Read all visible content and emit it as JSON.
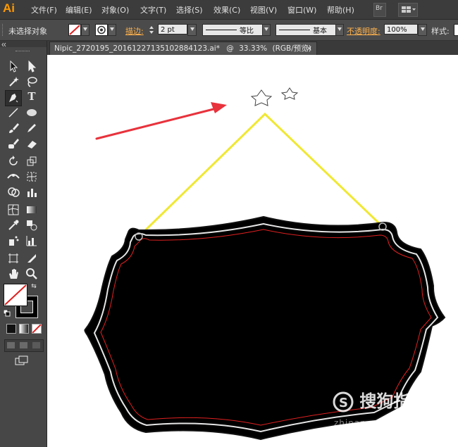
{
  "app": {
    "logo": "Ai"
  },
  "menu": [
    "文件(F)",
    "编辑(E)",
    "对象(O)",
    "文字(T)",
    "选择(S)",
    "效果(C)",
    "视图(V)",
    "窗口(W)",
    "帮助(H)"
  ],
  "menu_buttons": {
    "bridge": "Br"
  },
  "control": {
    "selection": "未选择对象",
    "stroke_label": "描边:",
    "stroke_value": "2 pt",
    "profile_uniform": "等比",
    "brush_basic": "基本",
    "opacity_label": "不透明度:",
    "opacity_value": "100%",
    "style_label": "样式:"
  },
  "document": {
    "tab_title": "Nipic_2720195_20161227135102884123.ai*",
    "zoom": "33.33%",
    "color_mode": "(RGB/预览)",
    "close": "×"
  },
  "toolbox": {
    "tools": [
      "selection-tool",
      "direct-selection-tool",
      "magic-wand-tool",
      "lasso-tool",
      "pen-tool",
      "type-tool",
      "line-tool",
      "ellipse-tool",
      "paintbrush-tool",
      "pencil-tool",
      "blob-brush-tool",
      "eraser-tool",
      "rotate-tool",
      "scale-tool",
      "width-tool",
      "free-transform-tool",
      "shape-builder-tool",
      "perspective-grid-tool",
      "mesh-tool",
      "gradient-tool",
      "eyedropper-tool",
      "blend-tool",
      "symbol-sprayer-tool",
      "column-graph-tool",
      "artboard-tool",
      "slice-tool",
      "hand-tool",
      "zoom-tool"
    ],
    "colors": {
      "fill": "#ffffff",
      "stroke": "#000000",
      "none_slash": "#e02020"
    }
  },
  "artwork": {
    "accent_arrow": "#e8323c",
    "hanger_string": "#f0e832",
    "sign_fill": "#000000",
    "sign_inner_line": "#e02020"
  },
  "watermark": {
    "text": "搜狗指南",
    "sub": "zhinan.sogou.com"
  }
}
